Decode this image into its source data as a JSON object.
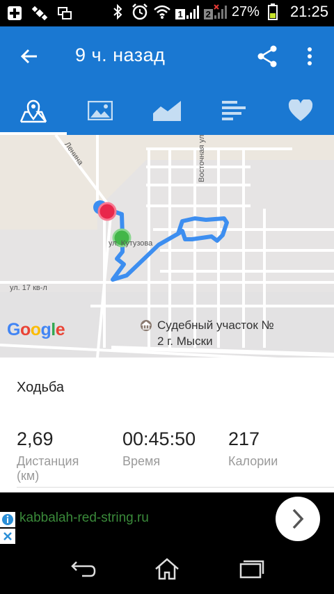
{
  "status_bar": {
    "battery": "27%",
    "time": "21:25",
    "sim1": "1",
    "sim2": "2"
  },
  "appbar": {
    "title": "9 ч. назад"
  },
  "tabs": [
    {
      "name": "map",
      "icon": "map-icon",
      "selected": true
    },
    {
      "name": "photos",
      "icon": "image-icon",
      "selected": false
    },
    {
      "name": "charts",
      "icon": "area-chart-icon",
      "selected": false
    },
    {
      "name": "stats",
      "icon": "bar-list-icon",
      "selected": false
    },
    {
      "name": "health",
      "icon": "heart-icon",
      "selected": false
    }
  ],
  "map": {
    "labels": {
      "lenina": "Ленина",
      "vostochnaya": "Восточная ул.",
      "kutuzova": "ул. Кутузова",
      "kv17": "ул. 17 кв-л"
    },
    "google": "Google",
    "poi": "Судебный участок № 2 г. Мыски"
  },
  "activity": {
    "name": "Ходьба",
    "stats": [
      {
        "value": "2,69",
        "label": "Дистанция"
      },
      {
        "value": "00:45:50",
        "label": "Время"
      },
      {
        "value": "217",
        "label": "Калории"
      }
    ],
    "unit": "(км)"
  },
  "ad": {
    "url": "kabbalah-red-string.ru"
  },
  "colors": {
    "primary": "#1a78d2",
    "route": "#3d8ef0",
    "start": "#43b649",
    "end": "#e8274b"
  }
}
